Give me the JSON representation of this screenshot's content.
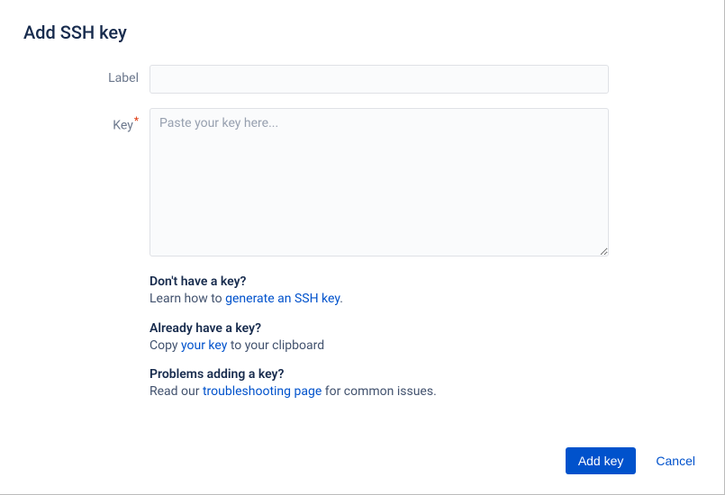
{
  "dialog": {
    "title": "Add SSH key"
  },
  "form": {
    "label_field_label": "Label",
    "label_field_value": "",
    "key_field_label": "Key",
    "key_field_required_mark": "*",
    "key_field_placeholder": "Paste your key here...",
    "key_field_value": ""
  },
  "help": {
    "no_key": {
      "title": "Don't have a key?",
      "text_before": "Learn how to ",
      "link": "generate an SSH key",
      "text_after": "."
    },
    "have_key": {
      "title": "Already have a key?",
      "text_before": "Copy ",
      "link": "your key",
      "text_after": " to your clipboard"
    },
    "problems": {
      "title": "Problems adding a key?",
      "text_before": "Read our ",
      "link": "troubleshooting page",
      "text_after": " for common issues."
    }
  },
  "footer": {
    "add_label": "Add key",
    "cancel_label": "Cancel"
  }
}
